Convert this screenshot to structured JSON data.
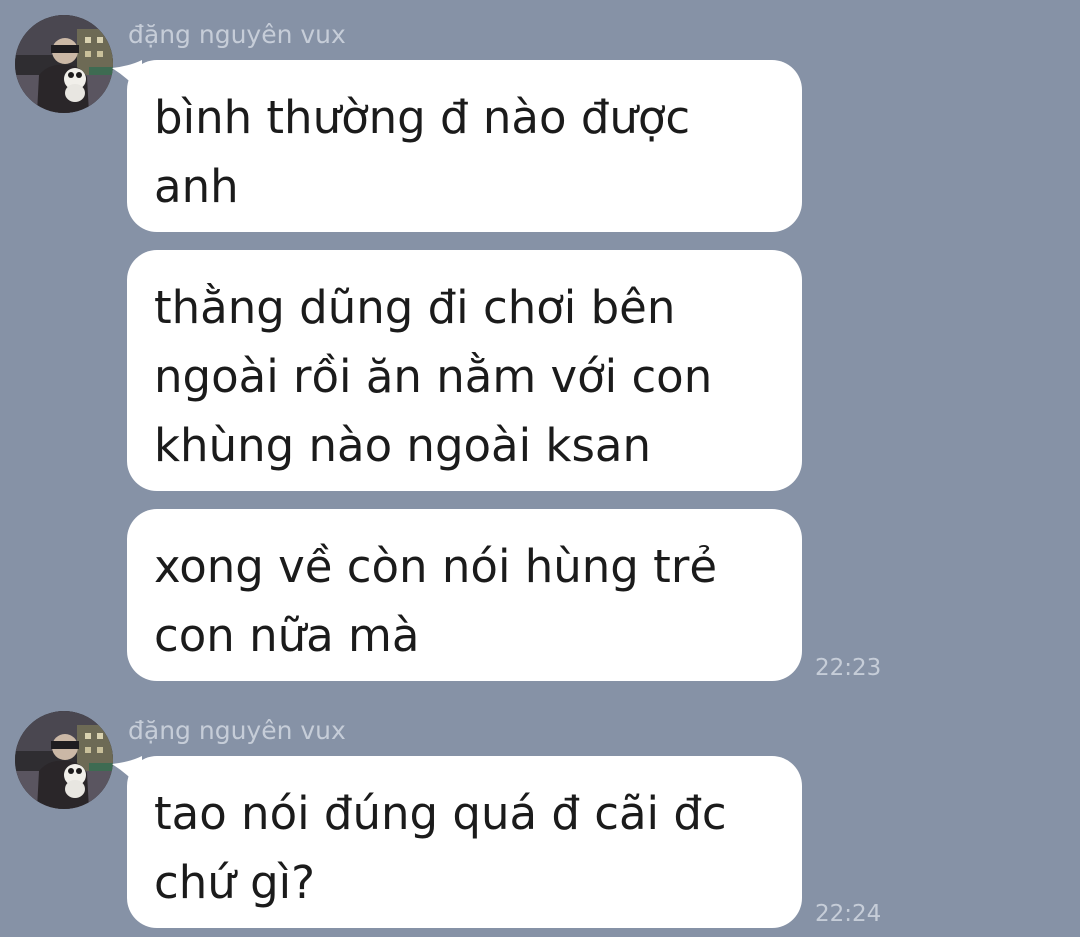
{
  "chat": {
    "background_color": "#8692a6",
    "bubble_color": "#ffffff",
    "groups": [
      {
        "sender": "đặng nguyên vux",
        "avatar_icon": "profile-photo",
        "messages": [
          "bình thường đ nào được\nanh",
          "thằng dũng đi chơi bên\nngoài rồi ăn nằm với con\nkhùng nào ngoài ksan",
          "xong về còn nói hùng trẻ\ncon nữa mà"
        ],
        "time": "22:23"
      },
      {
        "sender": "đặng nguyên vux",
        "avatar_icon": "profile-photo",
        "messages": [
          "tao nói đúng quá đ cãi đc\nchứ gì?"
        ],
        "time": "22:24"
      }
    ]
  }
}
